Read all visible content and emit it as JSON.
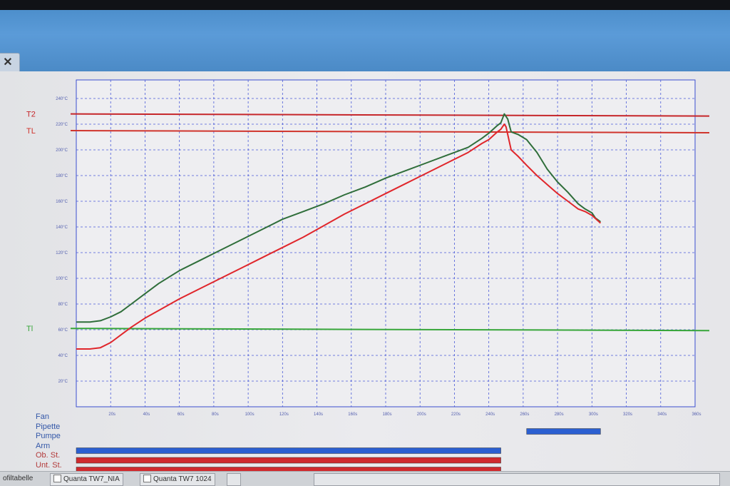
{
  "window": {
    "close_icon": "close-icon"
  },
  "chart_data": {
    "type": "line",
    "y_ticks": [
      "20°C",
      "40°C",
      "60°C",
      "80°C",
      "100°C",
      "120°C",
      "140°C",
      "160°C",
      "180°C",
      "200°C",
      "220°C",
      "240°C"
    ],
    "x_ticks": [
      "20s",
      "40s",
      "60s",
      "80s",
      "100s",
      "120s",
      "140s",
      "160s",
      "180s",
      "200s",
      "220s",
      "240s",
      "260s",
      "280s",
      "300s",
      "320s",
      "340s",
      "360s"
    ],
    "xlim": [
      0,
      360
    ],
    "ylim": [
      0,
      250
    ],
    "grid": true,
    "reference_lines": [
      {
        "label": "T2",
        "y": 228,
        "color": "#c6262a"
      },
      {
        "label": "TL",
        "y": 215,
        "color": "#d0342c"
      },
      {
        "label": "Tl",
        "y": 61,
        "color": "#37a63a"
      }
    ],
    "series": [
      {
        "color": "#2f6e3a",
        "x": [
          0,
          8,
          14,
          20,
          26,
          32,
          40,
          48,
          60,
          72,
          84,
          96,
          108,
          120,
          132,
          144,
          156,
          168,
          180,
          192,
          204,
          216,
          228,
          236,
          240,
          245,
          247,
          249,
          251,
          253,
          257,
          262,
          268,
          274,
          280,
          286,
          292,
          296,
          300,
          302,
          305
        ],
        "y": [
          66,
          66,
          67,
          70,
          74,
          80,
          88,
          96,
          106,
          114,
          122,
          130,
          138,
          146,
          152,
          158,
          165,
          171,
          178,
          184,
          190,
          196,
          202,
          209,
          213,
          219,
          221,
          228,
          224,
          214,
          212,
          208,
          198,
          185,
          175,
          167,
          158,
          154,
          151,
          147,
          144
        ]
      },
      {
        "color": "#e0262b",
        "x": [
          0,
          8,
          14,
          20,
          26,
          32,
          40,
          48,
          60,
          72,
          84,
          96,
          108,
          120,
          132,
          144,
          156,
          168,
          180,
          192,
          204,
          216,
          228,
          236,
          240,
          245,
          247,
          249,
          250,
          251,
          253,
          257,
          262,
          268,
          274,
          280,
          286,
          292,
          296,
          300,
          305
        ],
        "y": [
          45,
          45,
          46,
          50,
          56,
          62,
          69,
          75,
          84,
          92,
          100,
          108,
          116,
          124,
          132,
          141,
          150,
          158,
          166,
          174,
          182,
          190,
          198,
          205,
          208,
          214,
          216,
          220,
          218,
          212,
          200,
          195,
          188,
          180,
          173,
          166,
          160,
          154,
          152,
          149,
          143
        ]
      }
    ]
  },
  "process_bars": {
    "labels": [
      "Fan",
      "Pipette",
      "Pumpe",
      "Arm",
      "Ob. St.",
      "Unt. St."
    ],
    "rows": [
      {
        "label": "Fan",
        "segments": [],
        "color": "#2b5fd1"
      },
      {
        "label": "Pipette",
        "segments": [
          [
            262,
            305
          ]
        ],
        "color": "#2b5fd1"
      },
      {
        "label": "Pumpe",
        "segments": [],
        "color": "#2b5fd1"
      },
      {
        "label": "Arm",
        "segments": [
          [
            0,
            247
          ]
        ],
        "color": "#2b5fd1"
      },
      {
        "label": "Ob. St.",
        "segments": [
          [
            0,
            247
          ]
        ],
        "color": "#d02a2e"
      },
      {
        "label": "Unt. St.",
        "segments": [
          [
            0,
            247
          ]
        ],
        "color": "#d02a2e"
      }
    ],
    "extra_bar": {
      "segment": [
        0,
        258
      ],
      "color": "#d02a2e"
    }
  },
  "status_bar": {
    "items": [
      "ofiltabelle",
      "Quanta TW7_NIA",
      "Quanta TW7 1024"
    ]
  }
}
